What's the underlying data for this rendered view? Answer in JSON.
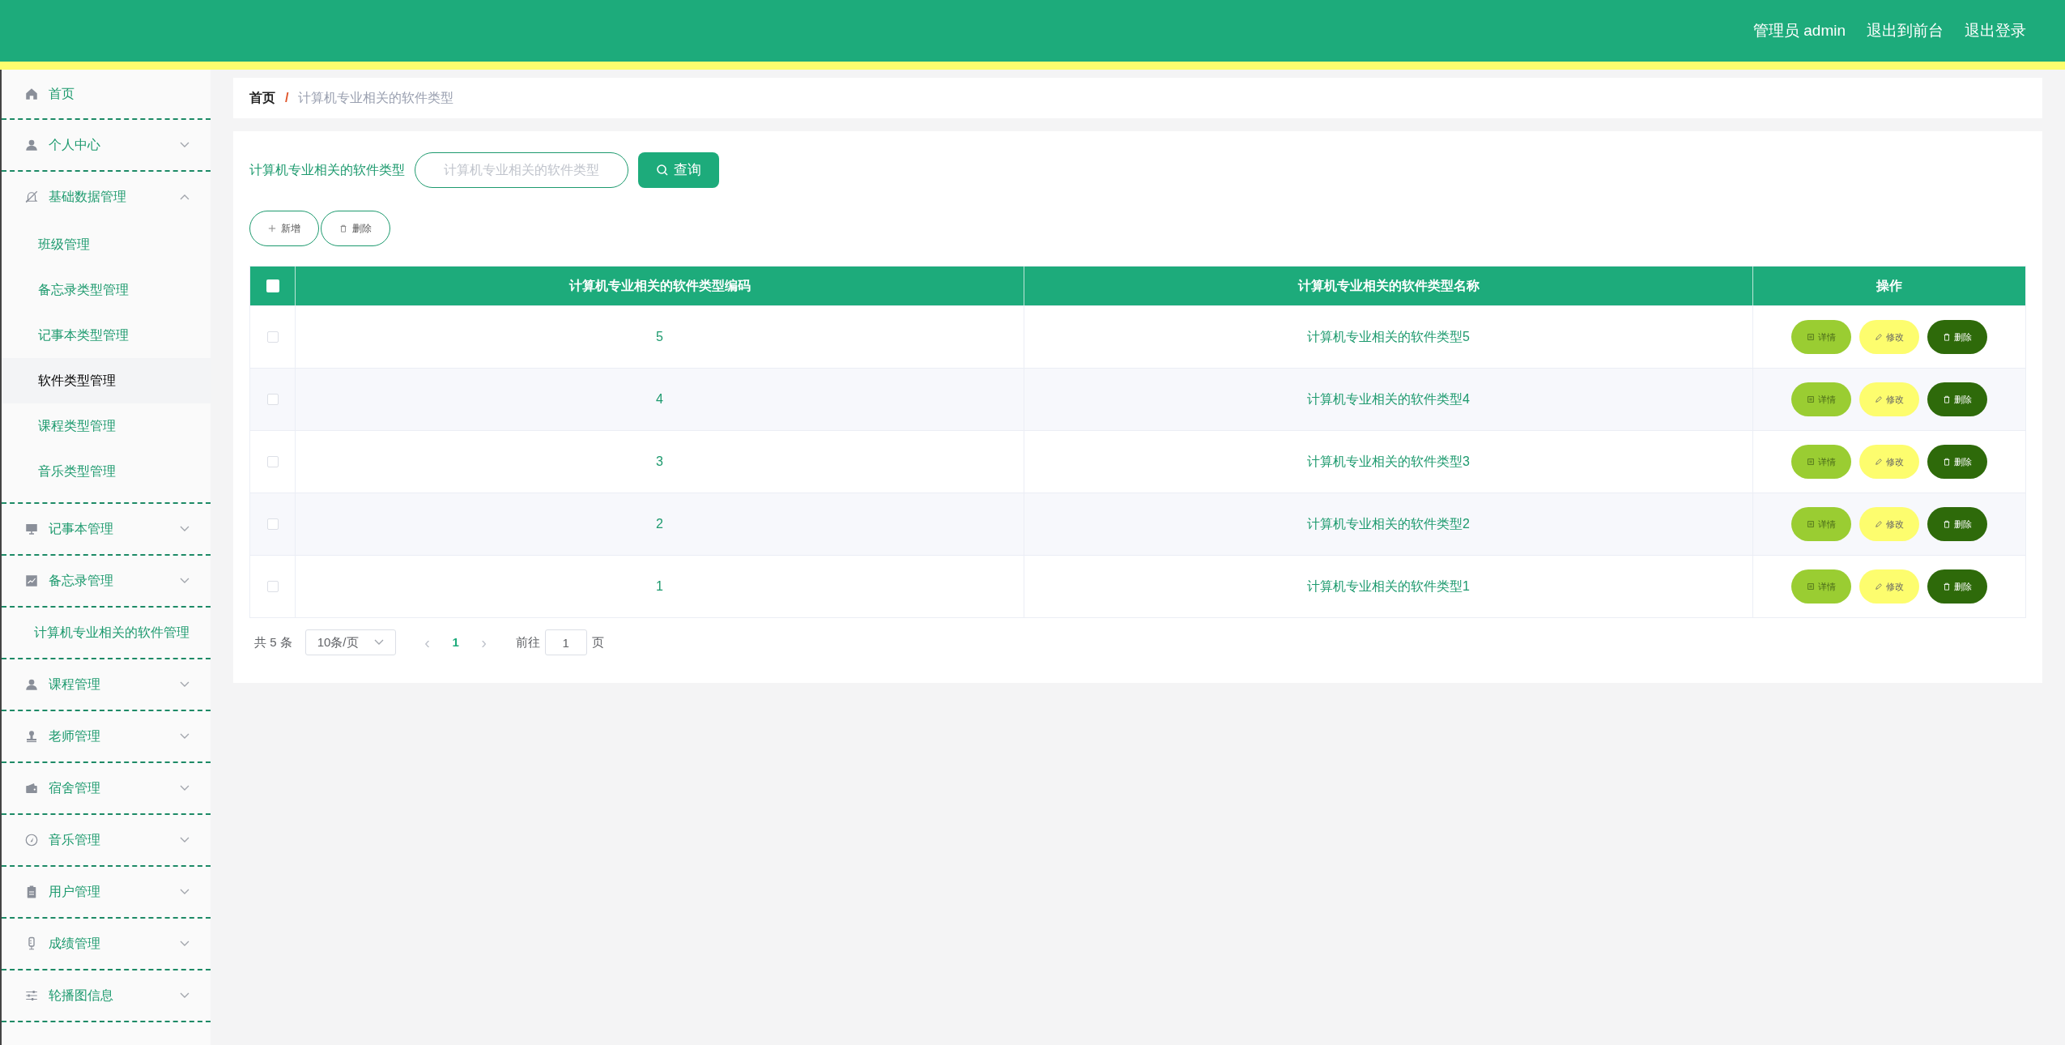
{
  "header": {
    "user": "管理员 admin",
    "links": [
      "退出到前台",
      "退出登录"
    ]
  },
  "sidebar": {
    "items": [
      {
        "label": "首页",
        "expandable": false
      },
      {
        "label": "个人中心",
        "expandable": true,
        "expanded": false
      },
      {
        "label": "基础数据管理",
        "expandable": true,
        "expanded": true,
        "children": [
          {
            "label": "班级管理",
            "selected": false
          },
          {
            "label": "备忘录类型管理",
            "selected": false
          },
          {
            "label": "记事本类型管理",
            "selected": false
          },
          {
            "label": "软件类型管理",
            "selected": true
          },
          {
            "label": "课程类型管理",
            "selected": false
          },
          {
            "label": "音乐类型管理",
            "selected": false
          }
        ]
      },
      {
        "label": "记事本管理",
        "expandable": true,
        "expanded": false
      },
      {
        "label": "备忘录管理",
        "expandable": true,
        "expanded": false
      },
      {
        "label": "计算机专业相关的软件管理",
        "expandable": false
      },
      {
        "label": "课程管理",
        "expandable": true,
        "expanded": false
      },
      {
        "label": "老师管理",
        "expandable": true,
        "expanded": false
      },
      {
        "label": "宿舍管理",
        "expandable": true,
        "expanded": false
      },
      {
        "label": "音乐管理",
        "expandable": true,
        "expanded": false
      },
      {
        "label": "用户管理",
        "expandable": true,
        "expanded": false
      },
      {
        "label": "成绩管理",
        "expandable": true,
        "expanded": false
      },
      {
        "label": "轮播图信息",
        "expandable": true,
        "expanded": false
      }
    ]
  },
  "breadcrumb": {
    "home": "首页",
    "separator": "/",
    "current": "计算机专业相关的软件类型"
  },
  "search": {
    "label": "计算机专业相关的软件类型",
    "placeholder": "计算机专业相关的软件类型",
    "button": "查询"
  },
  "actions": [
    "新增",
    "删除"
  ],
  "table": {
    "columns": [
      "计算机专业相关的软件类型编码",
      "计算机专业相关的软件类型名称",
      "操作"
    ],
    "all_checked": false,
    "rows": [
      {
        "checked": false,
        "code": "5",
        "name": "计算机专业相关的软件类型5",
        "buttons": [
          "详情",
          "修改",
          "删除"
        ]
      },
      {
        "checked": false,
        "code": "4",
        "name": "计算机专业相关的软件类型4",
        "buttons": [
          "详情",
          "修改",
          "删除"
        ]
      },
      {
        "checked": false,
        "code": "3",
        "name": "计算机专业相关的软件类型3",
        "buttons": [
          "详情",
          "修改",
          "删除"
        ]
      },
      {
        "checked": false,
        "code": "2",
        "name": "计算机专业相关的软件类型2",
        "buttons": [
          "详情",
          "修改",
          "删除"
        ]
      },
      {
        "checked": false,
        "code": "1",
        "name": "计算机专业相关的软件类型1",
        "buttons": [
          "详情",
          "修改",
          "删除"
        ]
      }
    ]
  },
  "pagination": {
    "total": "共 5 条",
    "page_size": "10条/页",
    "prev": "‹",
    "pages": [
      {
        "label": "1",
        "selected": true
      }
    ],
    "next": "›",
    "goto_label": "前往",
    "goto_value": "1",
    "goto_suffix": "页"
  }
}
